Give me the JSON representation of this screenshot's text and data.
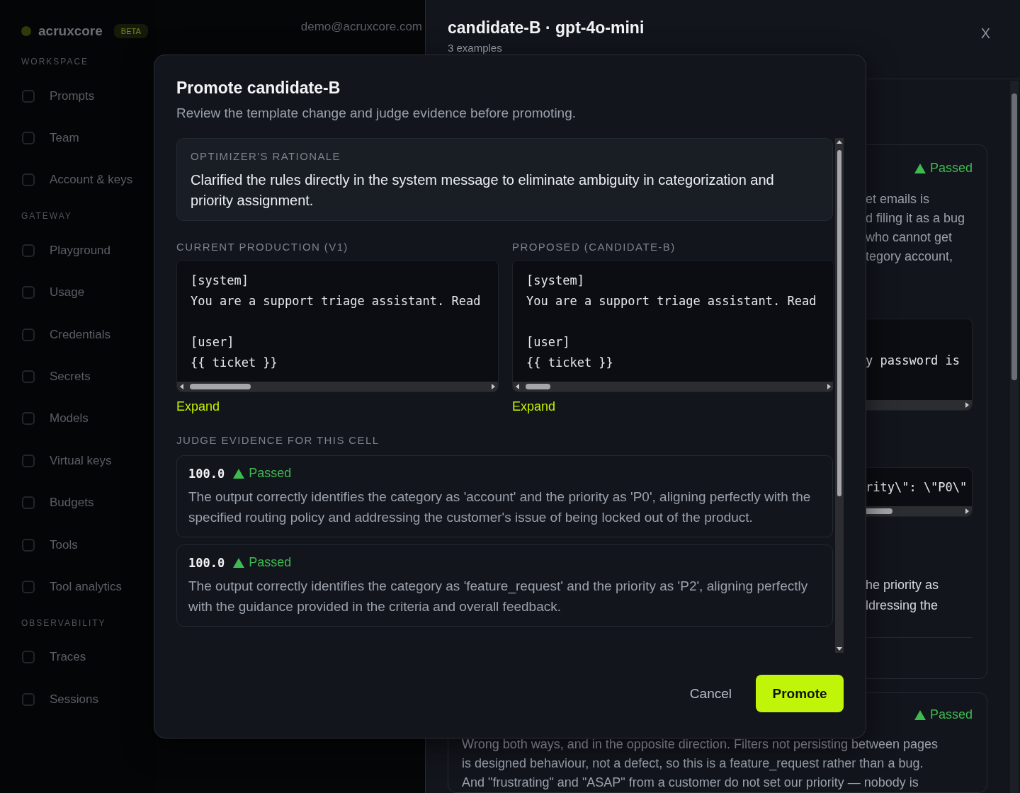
{
  "app": {
    "logo": "acruxcore",
    "badge": "BETA",
    "user_email": "demo@acruxcore.com",
    "nav_sections": [
      {
        "title": "WORKSPACE",
        "items": [
          {
            "label": "Prompts"
          },
          {
            "label": "Team"
          },
          {
            "label": "Account & keys"
          }
        ]
      },
      {
        "title": "GATEWAY",
        "items": [
          {
            "label": "Playground"
          },
          {
            "label": "Usage"
          },
          {
            "label": "Credentials"
          },
          {
            "label": "Secrets"
          },
          {
            "label": "Models"
          },
          {
            "label": "Virtual keys"
          },
          {
            "label": "Budgets"
          },
          {
            "label": "Tools"
          },
          {
            "label": "Tool analytics"
          }
        ]
      },
      {
        "title": "OBSERVABILITY",
        "items": [
          {
            "label": "Traces"
          },
          {
            "label": "Sessions"
          }
        ]
      }
    ]
  },
  "drawer": {
    "title": "candidate-B · gpt-4o-mini",
    "subtitle": "3 examples",
    "close": "X",
    "cards": [
      {
        "status": "Passed",
        "passed": true,
        "text_1": [
          "et emails is",
          "d filing it as a bug",
          "who cannot get",
          "tegory account,"
        ],
        "code_1": "y password is",
        "code_2": "rity\\\": \\\"P0\\\"",
        "text_2": [
          "he priority as",
          "ldressing the"
        ]
      },
      {
        "status": "Passed",
        "passed": true,
        "paragraph": [
          "Wrong both ways, and in the opposite direction. Filters not persisting between pages",
          "is designed behaviour, not a defect, so this is a feature_request rather than a bug.",
          "And \"frustrating\" and \"ASAP\" from a customer do not set our priority — nobody is"
        ]
      }
    ]
  },
  "modal": {
    "title": "Promote candidate-B",
    "subtitle": "Review the template change and judge evidence before promoting.",
    "rationale": {
      "label": "OPTIMIZER'S RATIONALE",
      "text": "Clarified the rules directly in the system message to eliminate ambiguity in categorization and priority assignment."
    },
    "templates": [
      {
        "label": "CURRENT PRODUCTION (V1)",
        "system_lines": [
          "[system]",
          "You are a support triage assistant. Read"
        ],
        "user_lines": [
          "[user]",
          "{{ ticket }}"
        ],
        "expand": "Expand"
      },
      {
        "label": "PROPOSED (CANDIDATE-B)",
        "system_lines": [
          "[system]",
          "You are a support triage assistant. Read"
        ],
        "user_lines": [
          "[user]",
          "{{ ticket }}"
        ],
        "expand": "Expand"
      }
    ],
    "evidence_label": "JUDGE EVIDENCE FOR THIS CELL",
    "evidence": [
      {
        "score": "100.0",
        "status": "Passed",
        "passed": true,
        "text": "The output correctly identifies the category as 'account' and the priority as 'P0', aligning perfectly with the specified routing policy and addressing the customer's issue of being locked out of the product."
      },
      {
        "score": "100.0",
        "status": "Passed",
        "passed": true,
        "text": "The output correctly identifies the category as 'feature_request' and the priority as 'P2', aligning perfectly with the guidance provided in the criteria and overall feedback."
      }
    ],
    "buttons": [
      {
        "label": "Cancel",
        "kind": "secondary"
      },
      {
        "label": "Promote",
        "kind": "primary"
      }
    ]
  }
}
